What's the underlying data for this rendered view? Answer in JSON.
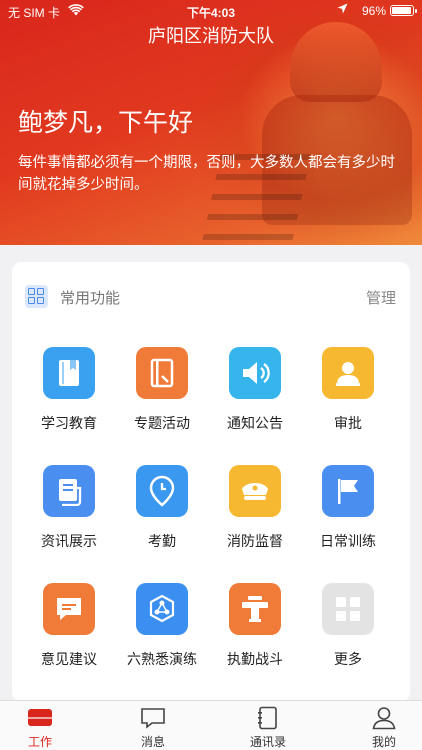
{
  "status_bar": {
    "carrier": "无 SIM 卡",
    "time": "下午4:03",
    "battery": "96%",
    "battery_level": 0.96
  },
  "header": {
    "title": "庐阳区消防大队",
    "greeting": "鲍梦凡，下午好",
    "motto": "每件事情都必须有一个期限，否则，大多数人都会有多少时间就花掉多少时间。"
  },
  "card": {
    "title": "常用功能",
    "manage": "管理"
  },
  "functions": [
    {
      "label": "学习教育",
      "icon": "book-icon",
      "color": "#3aa0f0"
    },
    {
      "label": "专题活动",
      "icon": "notebook-icon",
      "color": "#f07a37"
    },
    {
      "label": "通知公告",
      "icon": "speaker-icon",
      "color": "#35b5ec"
    },
    {
      "label": "审批",
      "icon": "approver-icon",
      "color": "#f5b830"
    },
    {
      "label": "资讯展示",
      "icon": "news-icon",
      "color": "#4a8ff0"
    },
    {
      "label": "考勤",
      "icon": "location-pin-icon",
      "color": "#3b98f0"
    },
    {
      "label": "消防监督",
      "icon": "officer-cap-icon",
      "color": "#f5b830"
    },
    {
      "label": "日常训练",
      "icon": "flag-icon",
      "color": "#4a8ff0"
    },
    {
      "label": "意见建议",
      "icon": "message-icon",
      "color": "#f07a37"
    },
    {
      "label": "六熟悉演练",
      "icon": "hexagon-network-icon",
      "color": "#3b8ff0"
    },
    {
      "label": "执勤战斗",
      "icon": "hydrant-icon",
      "color": "#f07a37"
    },
    {
      "label": "更多",
      "icon": "more-grid-icon",
      "color": "#e3e3e3"
    }
  ],
  "tabs": [
    {
      "label": "工作",
      "icon": "work-icon",
      "active": true
    },
    {
      "label": "消息",
      "icon": "message-bubble-icon",
      "active": false
    },
    {
      "label": "通讯录",
      "icon": "contacts-book-icon",
      "active": false
    },
    {
      "label": "我的",
      "icon": "user-profile-icon",
      "active": false
    }
  ],
  "colors": {
    "brand_red": "#d9261c",
    "header_orange": "#ef8a3a"
  }
}
